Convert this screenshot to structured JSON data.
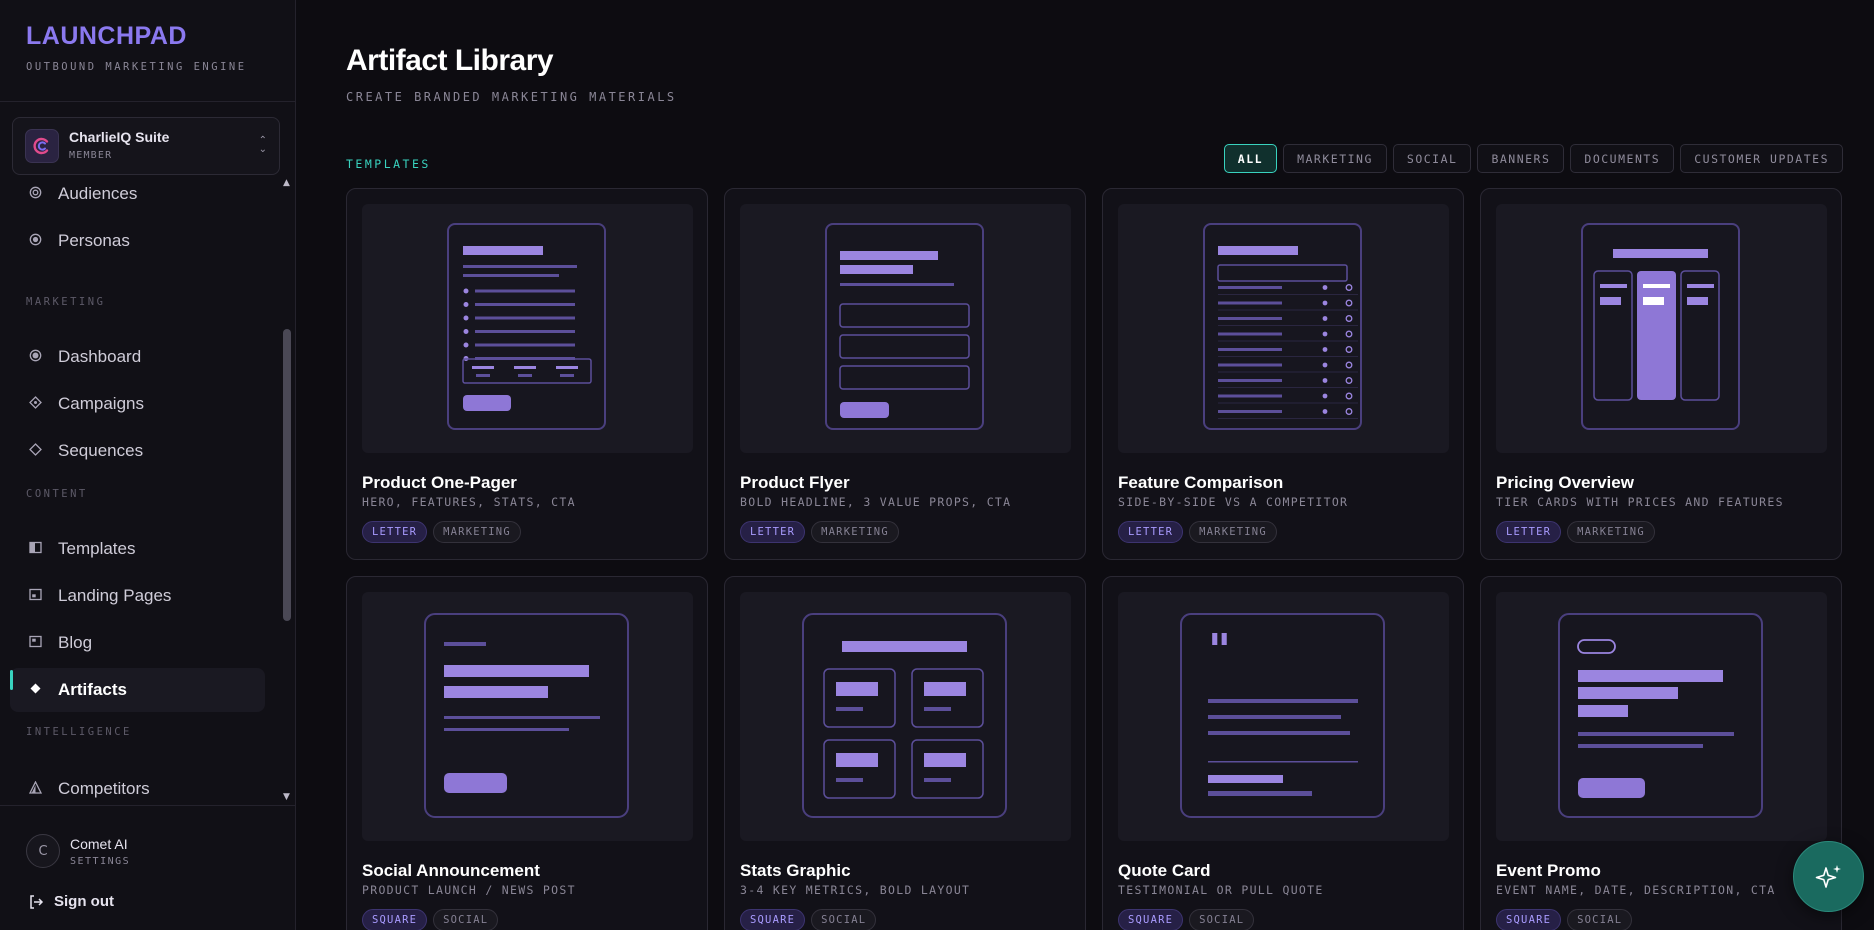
{
  "brand": {
    "title": "LAUNCHPAD",
    "subtitle": "OUTBOUND MARKETING ENGINE"
  },
  "workspace": {
    "name": "CharlieIQ Suite",
    "role": "MEMBER"
  },
  "sidebar": {
    "items": [
      {
        "label": "Audiences",
        "icon": "target-icon"
      },
      {
        "label": "Personas",
        "icon": "persona-icon"
      },
      {
        "section": "MARKETING"
      },
      {
        "label": "Dashboard",
        "icon": "dashboard-icon"
      },
      {
        "label": "Campaigns",
        "icon": "campaigns-icon"
      },
      {
        "label": "Sequences",
        "icon": "sequences-icon"
      },
      {
        "section": "CONTENT"
      },
      {
        "label": "Templates",
        "icon": "templates-icon"
      },
      {
        "label": "Landing Pages",
        "icon": "landing-pages-icon"
      },
      {
        "label": "Blog",
        "icon": "blog-icon"
      },
      {
        "label": "Artifacts",
        "icon": "artifacts-icon",
        "active": true
      },
      {
        "section": "INTELLIGENCE"
      },
      {
        "label": "Competitors",
        "icon": "competitors-icon"
      }
    ]
  },
  "user": {
    "initial": "C",
    "name": "Comet AI",
    "sub": "SETTINGS"
  },
  "signout": {
    "label": "Sign out"
  },
  "page": {
    "title": "Artifact Library",
    "subtitle": "CREATE BRANDED MARKETING MATERIALS"
  },
  "section_label": "TEMPLATES",
  "filters": [
    "ALL",
    "MARKETING",
    "SOCIAL",
    "BANNERS",
    "DOCUMENTS",
    "CUSTOMER UPDATES"
  ],
  "active_filter": "ALL",
  "cards": [
    {
      "title": "Product One-Pager",
      "desc": "HERO, FEATURES, STATS, CTA",
      "tags": [
        "LETTER",
        "MARKETING"
      ],
      "preview": "one-pager"
    },
    {
      "title": "Product Flyer",
      "desc": "BOLD HEADLINE, 3 VALUE PROPS, CTA",
      "tags": [
        "LETTER",
        "MARKETING"
      ],
      "preview": "flyer"
    },
    {
      "title": "Feature Comparison",
      "desc": "SIDE-BY-SIDE VS A COMPETITOR",
      "tags": [
        "LETTER",
        "MARKETING"
      ],
      "preview": "comparison"
    },
    {
      "title": "Pricing Overview",
      "desc": "TIER CARDS WITH PRICES AND FEATURES",
      "tags": [
        "LETTER",
        "MARKETING"
      ],
      "preview": "pricing"
    },
    {
      "title": "Social Announcement",
      "desc": "PRODUCT LAUNCH / NEWS POST",
      "tags": [
        "SQUARE",
        "SOCIAL"
      ],
      "preview": "social"
    },
    {
      "title": "Stats Graphic",
      "desc": "3-4 KEY METRICS, BOLD LAYOUT",
      "tags": [
        "SQUARE",
        "SOCIAL"
      ],
      "preview": "stats"
    },
    {
      "title": "Quote Card",
      "desc": "TESTIMONIAL OR PULL QUOTE",
      "tags": [
        "SQUARE",
        "SOCIAL"
      ],
      "preview": "quote"
    },
    {
      "title": "Event Promo",
      "desc": "EVENT NAME, DATE, DESCRIPTION, CTA",
      "tags": [
        "SQUARE",
        "SOCIAL"
      ],
      "preview": "event"
    }
  ],
  "colors": {
    "accent": "#8b79ef",
    "teal": "#39d3bf",
    "background": "#0d0c11"
  }
}
